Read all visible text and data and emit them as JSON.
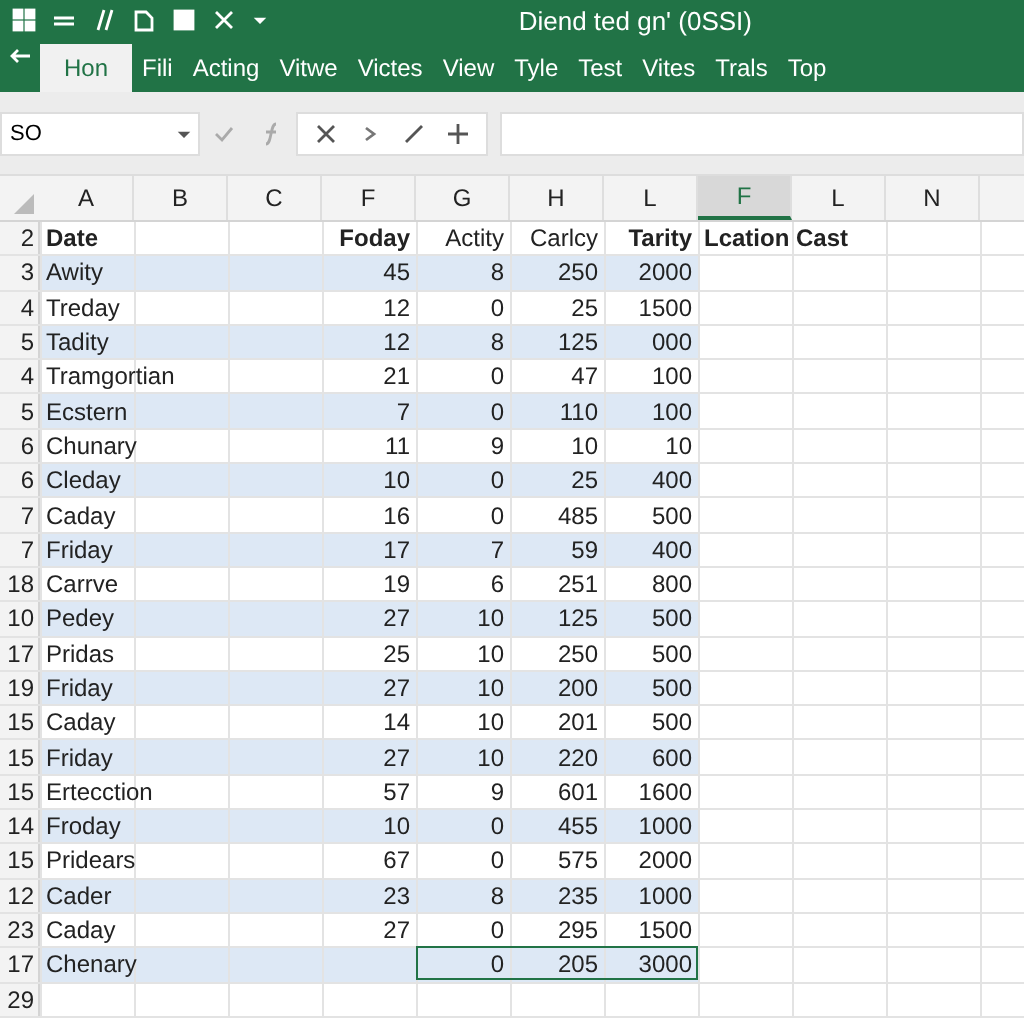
{
  "window": {
    "title": "Diend ted gn' (0SSI)"
  },
  "ribbon_tabs": [
    {
      "label": "Hon",
      "selected": true
    },
    {
      "label": "Fili",
      "selected": false
    },
    {
      "label": "Acting",
      "selected": false
    },
    {
      "label": "Vitwe",
      "selected": false
    },
    {
      "label": "Victes",
      "selected": false
    },
    {
      "label": "View",
      "selected": false
    },
    {
      "label": "Tyle",
      "selected": false
    },
    {
      "label": "Test",
      "selected": false
    },
    {
      "label": "Vites",
      "selected": false
    },
    {
      "label": "Trals",
      "selected": false
    },
    {
      "label": "Top",
      "selected": false
    }
  ],
  "name_box": {
    "value": "SO"
  },
  "column_headers": [
    {
      "label": "A",
      "selected": false
    },
    {
      "label": "B",
      "selected": false
    },
    {
      "label": "C",
      "selected": false
    },
    {
      "label": "F",
      "selected": false
    },
    {
      "label": "G",
      "selected": false
    },
    {
      "label": "H",
      "selected": false
    },
    {
      "label": "L",
      "selected": false
    },
    {
      "label": "F",
      "selected": true
    },
    {
      "label": "L",
      "selected": false
    },
    {
      "label": "N",
      "selected": false
    }
  ],
  "header_row": {
    "number": "2",
    "label": "Date",
    "cells": {
      "f": {
        "text": "Foday",
        "bold": true
      },
      "g": {
        "text": "Actity",
        "bold": false
      },
      "h": {
        "text": "Carlcy",
        "bold": false
      },
      "l": {
        "text": "Tarity",
        "bold": true
      },
      "f2": {
        "text": "Lcation Cast",
        "bold": true
      }
    }
  },
  "rows": [
    {
      "number": "3",
      "label": "Awity",
      "cells": {
        "f": "45",
        "g": "8",
        "h": "250",
        "l": "2000"
      },
      "selected": false
    },
    {
      "number": "4",
      "label": "Treday",
      "cells": {
        "f": "12",
        "g": "0",
        "h": "25",
        "l": "1500"
      },
      "selected": false
    },
    {
      "number": "5",
      "label": "Tadity",
      "cells": {
        "f": "12",
        "g": "8",
        "h": "125",
        "l": "000"
      },
      "selected": false
    },
    {
      "number": "4",
      "label": "Tramgortian",
      "cells": {
        "f": "21",
        "g": "0",
        "h": "47",
        "l": "100"
      },
      "selected": false
    },
    {
      "number": "5",
      "label": "Ecstern",
      "cells": {
        "f": "7",
        "g": "0",
        "h": "110",
        "l": "100"
      },
      "selected": false
    },
    {
      "number": "6",
      "label": "Chunary",
      "cells": {
        "f": "11",
        "g": "9",
        "h": "10",
        "l": "10"
      },
      "selected": false
    },
    {
      "number": "6",
      "label": "Cleday",
      "cells": {
        "f": "10",
        "g": "0",
        "h": "25",
        "l": "400"
      },
      "selected": false
    },
    {
      "number": "7",
      "label": "Caday",
      "cells": {
        "f": "16",
        "g": "0",
        "h": "485",
        "l": "500"
      },
      "selected": false
    },
    {
      "number": "7",
      "label": "Friday",
      "cells": {
        "f": "17",
        "g": "7",
        "h": "59",
        "l": "400"
      },
      "selected": false
    },
    {
      "number": "18",
      "label": "Carrve",
      "cells": {
        "f": "19",
        "g": "6",
        "h": "251",
        "l": "800"
      },
      "selected": false
    },
    {
      "number": "10",
      "label": "Pedey",
      "cells": {
        "f": "27",
        "g": "10",
        "h": "125",
        "l": "500"
      },
      "selected": false
    },
    {
      "number": "17",
      "label": "Pridas",
      "cells": {
        "f": "25",
        "g": "10",
        "h": "250",
        "l": "500"
      },
      "selected": false
    },
    {
      "number": "19",
      "label": "Friday",
      "cells": {
        "f": "27",
        "g": "10",
        "h": "200",
        "l": "500"
      },
      "selected": false
    },
    {
      "number": "15",
      "label": "Caday",
      "cells": {
        "f": "14",
        "g": "10",
        "h": "201",
        "l": "500"
      },
      "selected": false
    },
    {
      "number": "15",
      "label": "Friday",
      "cells": {
        "f": "27",
        "g": "10",
        "h": "220",
        "l": "600"
      },
      "selected": false
    },
    {
      "number": "15",
      "label": "Ertecction",
      "cells": {
        "f": "57",
        "g": "9",
        "h": "601",
        "l": "1600"
      },
      "selected": false
    },
    {
      "number": "14",
      "label": "Froday",
      "cells": {
        "f": "10",
        "g": "0",
        "h": "455",
        "l": "1000"
      },
      "selected": false
    },
    {
      "number": "15",
      "label": "Pridears",
      "cells": {
        "f": "67",
        "g": "0",
        "h": "575",
        "l": "2000"
      },
      "selected": false
    },
    {
      "number": "12",
      "label": "Cader",
      "cells": {
        "f": "23",
        "g": "8",
        "h": "235",
        "l": "1000"
      },
      "selected": false
    },
    {
      "number": "23",
      "label": "Caday",
      "cells": {
        "f": "27",
        "g": "0",
        "h": "295",
        "l": "1500"
      },
      "selected": false
    },
    {
      "number": "17",
      "label": "Chenary",
      "cells": {
        "g": "0",
        "h": "205",
        "l": "3000"
      },
      "selected": true
    },
    {
      "number": "29",
      "selected": false
    }
  ]
}
